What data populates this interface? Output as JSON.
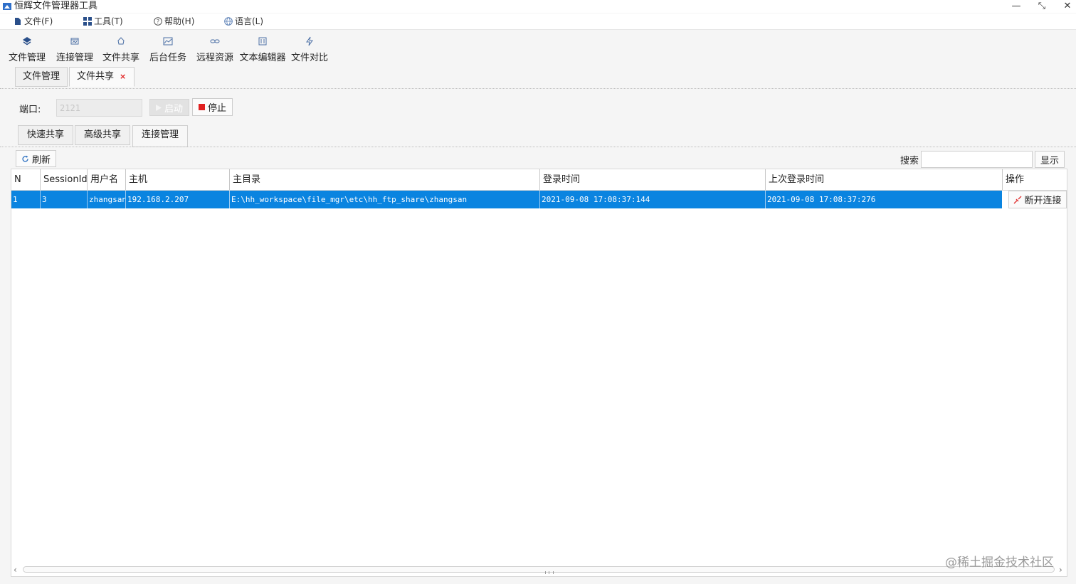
{
  "app": {
    "title": "恒辉文件管理器工具"
  },
  "window_controls": {
    "minimize": "—",
    "restore": "⤡",
    "close": "✕"
  },
  "menu": [
    {
      "label": "文件(F)",
      "icon": "file-icon"
    },
    {
      "label": "工具(T)",
      "icon": "grid-icon"
    },
    {
      "label": "帮助(H)",
      "icon": "help-icon"
    },
    {
      "label": "语言(L)",
      "icon": "globe-icon"
    }
  ],
  "toolbar": [
    {
      "label": "文件管理",
      "icon": "layers-icon"
    },
    {
      "label": "连接管理",
      "icon": "connection-icon"
    },
    {
      "label": "文件共享",
      "icon": "share-icon"
    },
    {
      "label": "后台任务",
      "icon": "chart-icon"
    },
    {
      "label": "远程资源",
      "icon": "link-icon"
    },
    {
      "label": "文本编辑器",
      "icon": "editor-icon"
    },
    {
      "label": "文件对比",
      "icon": "bolt-icon"
    }
  ],
  "doc_tabs": [
    {
      "label": "文件管理",
      "active": false
    },
    {
      "label": "文件共享",
      "active": true,
      "close": "×"
    }
  ],
  "port": {
    "label": "端口:",
    "value": "2121"
  },
  "server_buttons": {
    "start": "启动",
    "stop": "停止"
  },
  "sub_tabs": [
    {
      "label": "快速共享",
      "active": false
    },
    {
      "label": "高级共享",
      "active": false
    },
    {
      "label": "连接管理",
      "active": true
    }
  ],
  "actions": {
    "refresh": "刷新",
    "search_label": "搜索",
    "search_value": "",
    "show": "显示"
  },
  "table": {
    "columns": [
      "N",
      "SessionId",
      "用户名",
      "主机",
      "主目录",
      "登录时间",
      "上次登录时间",
      "操作"
    ],
    "rows": [
      {
        "n": "1",
        "session_id": "3",
        "username": "zhangsan",
        "host": "192.168.2.207",
        "home_dir": "E:\\hh_workspace\\file_mgr\\etc\\hh_ftp_share\\zhangsan",
        "login_time": "2021-09-08 17:08:37:144",
        "last_login_time": "2021-09-08 17:08:37:276",
        "action": "断开连接"
      }
    ]
  },
  "watermark": "@稀土掘金技术社区",
  "colors": {
    "selection": "#0a84e0",
    "stop_red": "#e02020",
    "tab_close_red": "#e02020"
  }
}
